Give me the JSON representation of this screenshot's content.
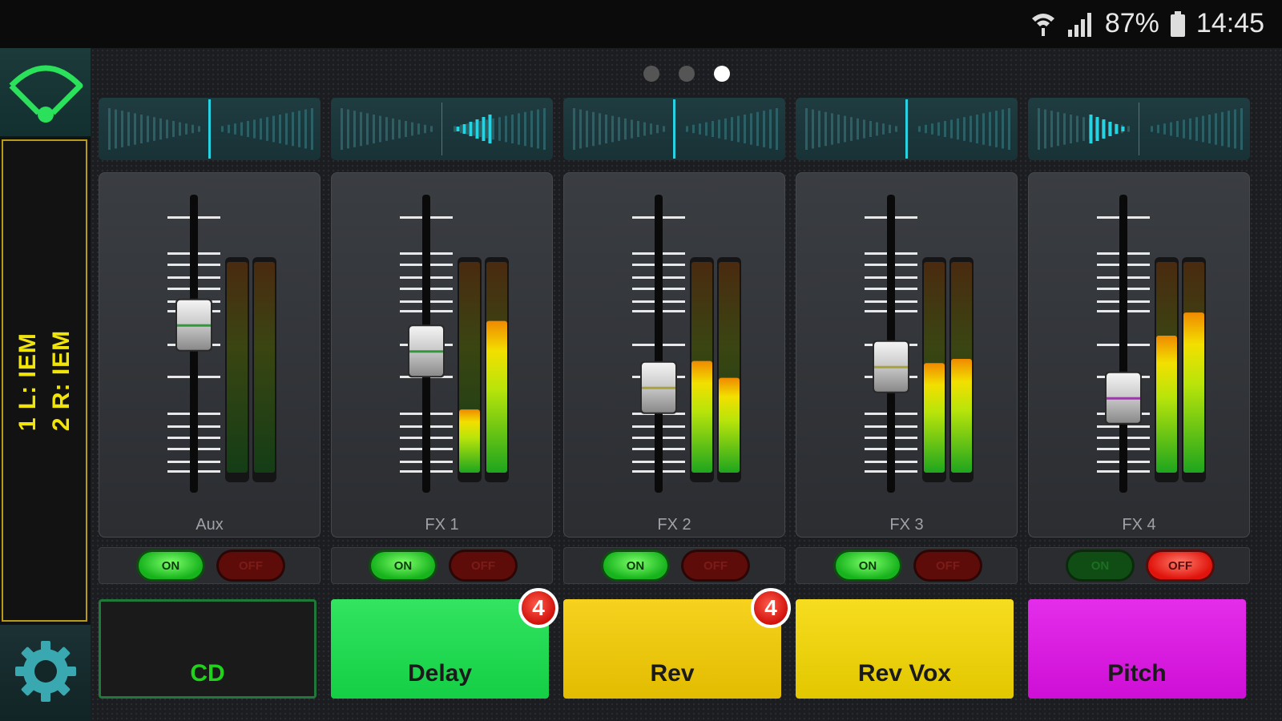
{
  "status_bar": {
    "battery": "87%",
    "time": "14:45"
  },
  "sidebar": {
    "wifi_icon": "wifi-icon",
    "mix_line_1": "1  L:  IEM",
    "mix_line_2": "2  R:  IEM",
    "settings_icon": "gear-icon"
  },
  "page_indicator": {
    "count": 3,
    "active": 3
  },
  "channels": [
    {
      "name": "Aux",
      "fader_level": 0.57,
      "fader_stripe": "#2f9a3a",
      "meter_left": 0.0,
      "meter_right": 0.0,
      "pan": 0.0,
      "on_label": "ON",
      "off_label": "OFF",
      "state": "on",
      "button_label": "CD",
      "button_color": "#1a1a1a",
      "label_color": "#21d21a",
      "badge": ""
    },
    {
      "name": "FX 1",
      "fader_level": 0.47,
      "fader_stripe": "#2f9a3a",
      "meter_left": 0.3,
      "meter_right": 0.72,
      "pan": 0.55,
      "on_label": "ON",
      "off_label": "OFF",
      "state": "on",
      "button_label": "Delay",
      "button_color": "#16e04b",
      "label_color": "#1a1a1a",
      "badge": "4"
    },
    {
      "name": "FX 2",
      "fader_level": 0.33,
      "fader_stripe": "#a8a23a",
      "meter_left": 0.53,
      "meter_right": 0.45,
      "pan": 0.0,
      "on_label": "ON",
      "off_label": "OFF",
      "state": "on",
      "button_label": "Rev",
      "button_color": "#f5cc00",
      "label_color": "#1a1a1a",
      "badge": "4"
    },
    {
      "name": "FX 3",
      "fader_level": 0.41,
      "fader_stripe": "#a8a23a",
      "meter_left": 0.52,
      "meter_right": 0.54,
      "pan": 0.0,
      "on_label": "ON",
      "off_label": "OFF",
      "state": "on",
      "button_label": "Rev Vox",
      "button_color": "#f5d800",
      "label_color": "#1a1a1a",
      "badge": ""
    },
    {
      "name": "FX 4",
      "fader_level": 0.29,
      "fader_stripe": "#9a3aa8",
      "meter_left": 0.65,
      "meter_right": 0.76,
      "pan": -0.55,
      "on_label": "ON",
      "off_label": "OFF",
      "state": "off",
      "button_label": "Pitch",
      "button_color": "#e010e8",
      "label_color": "#1a1a1a",
      "badge": ""
    }
  ]
}
